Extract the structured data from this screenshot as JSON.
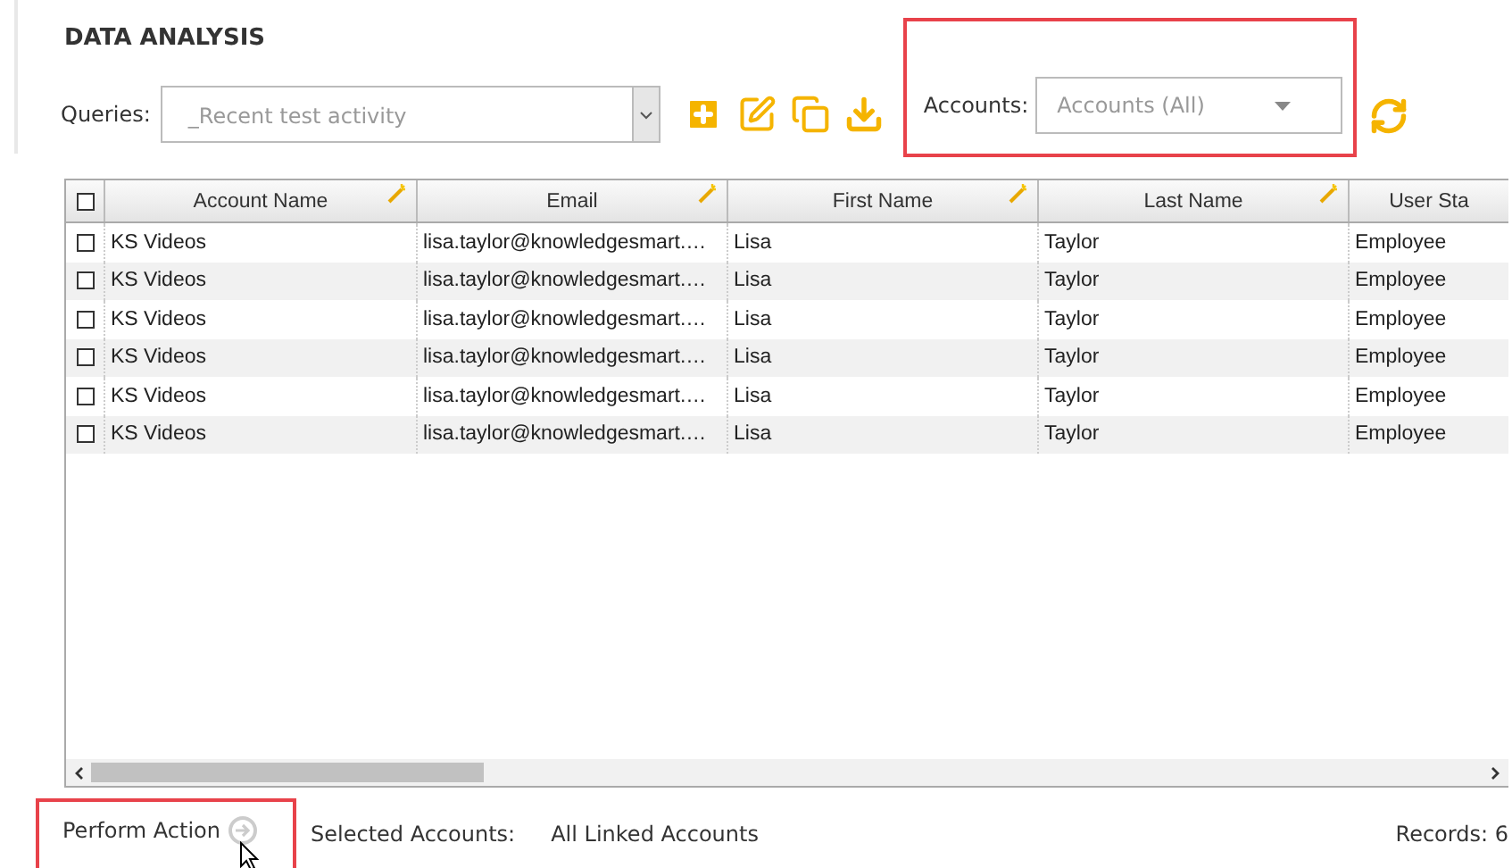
{
  "page_title": "DATA ANALYSIS",
  "queries": {
    "label": "Queries:",
    "value": "_Recent test activity"
  },
  "accounts": {
    "label": "Accounts:",
    "placeholder": "Accounts (All)",
    "highlighted": true
  },
  "table": {
    "header_checked": false,
    "columns": [
      "Account Name",
      "Email",
      "First Name",
      "Last Name",
      "User Sta"
    ],
    "rows": [
      {
        "checked": false,
        "cells": [
          "KS Videos",
          "lisa.taylor@knowledgesmart.…",
          "Lisa",
          "Taylor",
          "Employee"
        ]
      },
      {
        "checked": false,
        "cells": [
          "KS Videos",
          "lisa.taylor@knowledgesmart.…",
          "Lisa",
          "Taylor",
          "Employee"
        ]
      },
      {
        "checked": false,
        "cells": [
          "KS Videos",
          "lisa.taylor@knowledgesmart.…",
          "Lisa",
          "Taylor",
          "Employee"
        ]
      },
      {
        "checked": false,
        "cells": [
          "KS Videos",
          "lisa.taylor@knowledgesmart.…",
          "Lisa",
          "Taylor",
          "Employee"
        ]
      },
      {
        "checked": false,
        "cells": [
          "KS Videos",
          "lisa.taylor@knowledgesmart.…",
          "Lisa",
          "Taylor",
          "Employee"
        ]
      },
      {
        "checked": false,
        "cells": [
          "KS Videos",
          "lisa.taylor@knowledgesmart.…",
          "Lisa",
          "Taylor",
          "Employee"
        ]
      }
    ]
  },
  "footer": {
    "perform_action": "Perform Action",
    "perform_highlighted": true,
    "selected_label": "Selected Accounts:",
    "selected_value": "All Linked Accounts",
    "records": "Records: 6"
  }
}
